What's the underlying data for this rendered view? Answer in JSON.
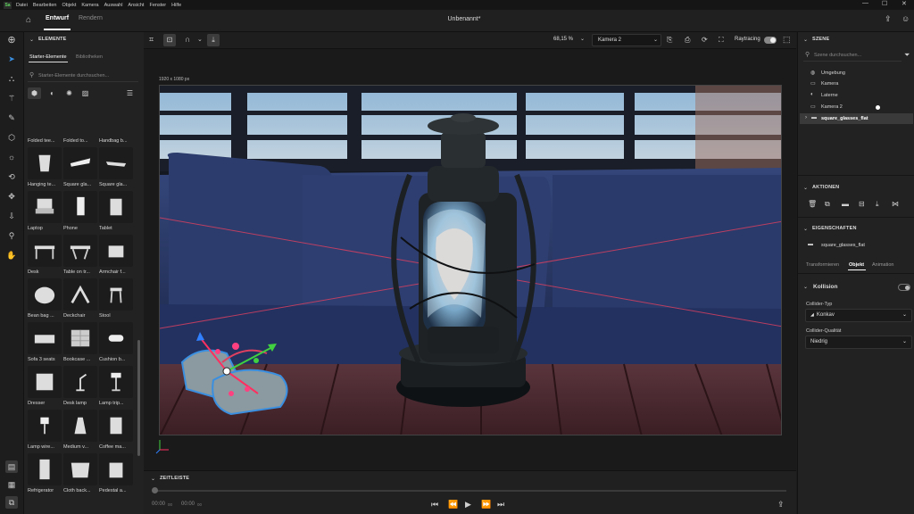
{
  "menubar": {
    "logo": "Sa",
    "items": [
      "Datei",
      "Bearbeiten",
      "Objekt",
      "Kamera",
      "Auswahl",
      "Ansicht",
      "Fenster",
      "Hilfe"
    ]
  },
  "appbar": {
    "tab_design": "Entwurf",
    "tab_render": "Rendern",
    "title": "Unbenannt*"
  },
  "assets": {
    "section": "ELEMENTE",
    "tab_starter": "Starter-Elemente",
    "tab_libraries": "Bibliotheken",
    "search_placeholder": "Starter-Elemente durchsuchen...",
    "items": [
      "Folded tee...",
      "Folded to...",
      "Handbag b...",
      "Hanging te...",
      "Square gla...",
      "Square gla...",
      "Laptop",
      "Phone",
      "Tablet",
      "Desk",
      "Table on tr...",
      "Armchair f...",
      "Bean bag ...",
      "Deckchair",
      "Stool",
      "Sofa 3 seats",
      "Bookcase ...",
      "Cushion b...",
      "Dresser",
      "Desk lamp",
      "Lamp trip...",
      "Lamp wire...",
      "Medium v...",
      "Coffee ma...",
      "Refrigerator",
      "Cloth back...",
      "Pedestal a..."
    ]
  },
  "viewport": {
    "zoom": "68,15 %",
    "camera": "Kamera 2",
    "raytracing": "Raytracing",
    "canvas_size": "1920 x 1080 px"
  },
  "timeline": {
    "section": "ZEITLEISTE",
    "time_start": "00:00",
    "time_start_frac": "00",
    "time_end": "00:00",
    "time_end_frac": "00"
  },
  "scene_panel": {
    "section": "SZENE",
    "search_placeholder": "Szene durchsuchen...",
    "items": [
      "Umgebung",
      "Kamera",
      "Laterne",
      "Kamera 2",
      "square_glasses_flat"
    ]
  },
  "actions": {
    "section": "AKTIONEN"
  },
  "properties": {
    "section": "EIGENSCHAFTEN",
    "object_name": "square_glasses_flat",
    "tabs": [
      "Transformieren",
      "Objekt",
      "Animation"
    ],
    "collision": "Kollision",
    "collider_type_label": "Collider-Typ",
    "collider_type_value": "Konkav",
    "collider_quality_label": "Collider-Qualität",
    "collider_quality_value": "Niedrig"
  },
  "colors": {
    "accent": "#3b8fe0",
    "sofa": "#2a3a6a",
    "table_wood": "#4a2a30",
    "selection": "#e04060",
    "gizmo_x": "#ff3060",
    "gizmo_y": "#40d040",
    "gizmo_z": "#3080ff"
  }
}
